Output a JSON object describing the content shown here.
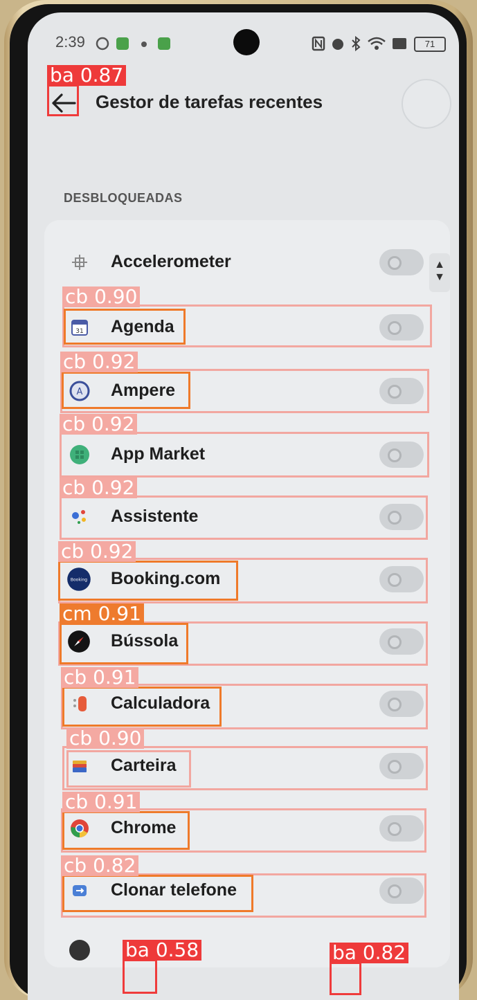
{
  "status_bar": {
    "time": "2:39",
    "battery": "71",
    "icons": [
      "nfc-icon",
      "alarm-icon",
      "bluetooth-icon",
      "wifi-icon",
      "battery-icon"
    ]
  },
  "header": {
    "title": "Gestor de tarefas recentes",
    "back_icon": "back-arrow-icon"
  },
  "section": {
    "title": "DESBLOQUEADAS"
  },
  "apps": [
    {
      "label": "Accelerometer",
      "icon": "accelerometer-icon",
      "enabled": false
    },
    {
      "label": "Agenda",
      "icon": "calendar-icon",
      "enabled": false
    },
    {
      "label": "Ampere",
      "icon": "ampere-icon",
      "enabled": false
    },
    {
      "label": "App Market",
      "icon": "app-market-icon",
      "enabled": false
    },
    {
      "label": "Assistente",
      "icon": "assistant-icon",
      "enabled": false
    },
    {
      "label": "Booking.com",
      "icon": "booking-icon",
      "enabled": false
    },
    {
      "label": "Bússola",
      "icon": "compass-icon",
      "enabled": false
    },
    {
      "label": "Calculadora",
      "icon": "calculator-icon",
      "enabled": false
    },
    {
      "label": "Carteira",
      "icon": "wallet-icon",
      "enabled": false
    },
    {
      "label": "Chrome",
      "icon": "chrome-icon",
      "enabled": false
    },
    {
      "label": "Clonar telefone",
      "icon": "clone-phone-icon",
      "enabled": false
    }
  ],
  "detections": [
    {
      "tag": "ba 0.87"
    },
    {
      "tag": "cb 0.90"
    },
    {
      "tag": "cb 0.92"
    },
    {
      "tag": "cb 0.92"
    },
    {
      "tag": "cb 0.92"
    },
    {
      "tag": "cb 0.92"
    },
    {
      "tag": "cm 0.91"
    },
    {
      "tag": "cb 0.91"
    },
    {
      "tag": "cb 0.90"
    },
    {
      "tag": "cb 0.91"
    },
    {
      "tag": "cb 0.82"
    },
    {
      "tag": "ba 0.58"
    },
    {
      "tag": "ba 0.82"
    }
  ],
  "colors": {
    "screen_bg": "#e4e6e8",
    "card_bg": "#ebedef",
    "toggle_off": "#cfd2d5",
    "det_pink": "#f2a7a0",
    "det_orange": "#ef7a2a",
    "det_red": "#ef3b3b"
  }
}
